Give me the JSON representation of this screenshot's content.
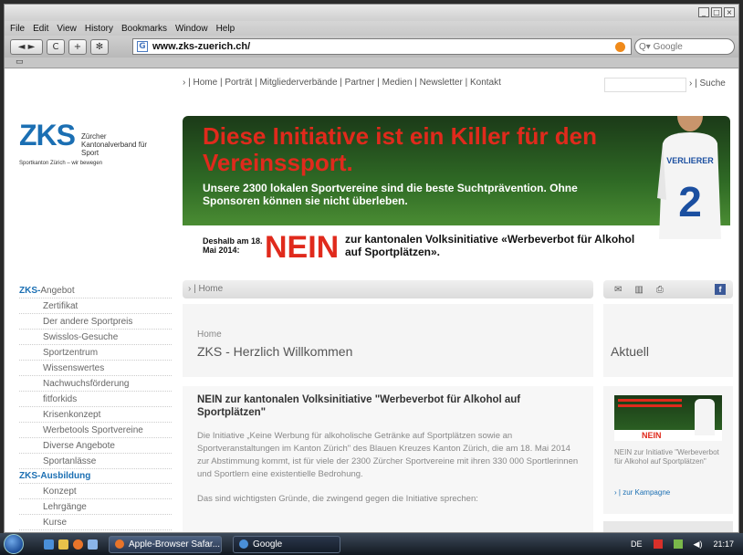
{
  "menubar": {
    "items": [
      "File",
      "Edit",
      "View",
      "History",
      "Bookmarks",
      "Window",
      "Help"
    ]
  },
  "toolbar": {
    "back_fwd": "◄ ►",
    "reload": "C",
    "add": "+",
    "bug": "✻",
    "url": "www.zks-zuerich.ch/",
    "search_placeholder": "Q▾ Google"
  },
  "bookmarks": {
    "icon": "book-icon"
  },
  "page": {
    "topnav": "› | Home | Porträt | Mitgliederverbände | Partner | Medien | Newsletter | Kontakt",
    "search_label": "› | Suche",
    "logo": {
      "zks": "ZKS",
      "name": "Zürcher Kantonalverband für Sport",
      "tagline": "Sportkanton Zürich – wir bewegen"
    },
    "banner": {
      "headline": "Diese Initiative ist ein Killer für den Vereinssport.",
      "sub": "Unsere 2300 lokalen Sportvereine sind die beste Suchtprävention. Ohne Sponsoren können sie nicht überleben.",
      "date": "Deshalb am 18. Mai 2014:",
      "nein": "NEIN",
      "initiative": "zur kantonalen Volksinitiative «Werbeverbot für Alkohol auf Sportplätzen».",
      "shirt_text": "VERLIERER",
      "shirt_number": "2"
    },
    "sidenav": {
      "section1": {
        "prefix": "ZKS-",
        "label": "Angebot"
      },
      "items1": [
        "Zertifikat",
        "Der andere Sportpreis",
        "Swisslos-Gesuche",
        "Sportzentrum",
        "Wissenswertes",
        "Nachwuchsförderung",
        "fitforkids",
        "Krisenkonzept",
        "Werbetools Sportvereine",
        "Diverse Angebote",
        "Sportanlässe"
      ],
      "section2": {
        "prefix": "ZKS-",
        "label": "Ausbildung"
      },
      "items2": [
        "Konzept",
        "Lehrgänge",
        "Kurse"
      ]
    },
    "crumb": "› | Home",
    "head": {
      "crumb": "Home",
      "title": "ZKS - Herzlich Willkommen"
    },
    "aktuell": "Aktuell",
    "article": {
      "title": "NEIN zur kantonalen Volksinitiative \"Werbeverbot für Alkohol auf Sportplätzen\"",
      "body": "Die Initiative „Keine Werbung für alkoholische Getränke auf Sportplätzen sowie an Sportveranstaltungen im Kanton Zürich\" des Blauen Kreuzes Kanton Zürich, die am 18. Mai 2014 zur Abstimmung kommt, ist für viele der 2300 Zürcher Sportvereine mit ihren 330 000 Sportlerinnen und Sportlern eine existentielle Bedrohung.",
      "foot": "Das sind wichtigsten Gründe, die zwingend gegen die Initiative sprechen:"
    },
    "sidebox": {
      "text": "NEIN zur Initiative \"Werbeverbot für Alkohol auf Sportplätzen\"",
      "link": "› | zur Kampagne"
    }
  },
  "taskbar": {
    "task1": "Apple-Browser Safar...",
    "task2": "Google",
    "lang": "DE",
    "time": "21:17"
  },
  "colors": {
    "brand_blue": "#1b6fb3",
    "banner_red": "#e02a1c",
    "banner_green": "#2f6a25"
  }
}
